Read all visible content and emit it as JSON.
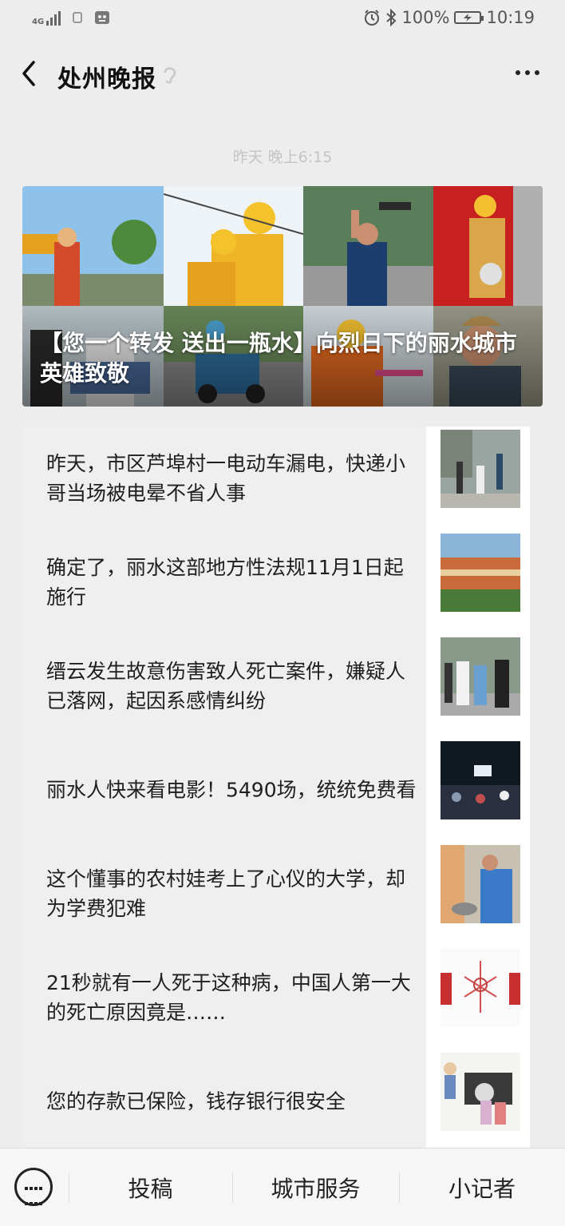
{
  "status": {
    "network": "4G",
    "battery": "100%",
    "time": "10:19"
  },
  "header": {
    "title": "处州晚报"
  },
  "message": {
    "timestamp": "昨天 晚上6:15",
    "hero_title": "【您一个转发 送出一瓶水】向烈日下的丽水城市英雄致敬",
    "articles": [
      {
        "title": "昨天，市区芦埠村一电动车漏电，快递小哥当场被电晕不省人事"
      },
      {
        "title": "确定了，丽水这部地方性法规11月1日起施行"
      },
      {
        "title": "缙云发生故意伤害致人死亡案件，嫌疑人已落网，起因系感情纠纷"
      },
      {
        "title": "丽水人快来看电影！5490场，统统免费看"
      },
      {
        "title": "这个懂事的农村娃考上了心仪的大学，却为学费犯难"
      },
      {
        "title": "21秒就有一人死于这种病，中国人第一大的死亡原因竟是……"
      },
      {
        "title": "您的存款已保险，钱存银行很安全"
      }
    ]
  },
  "bottom_menu": {
    "items": [
      "投稿",
      "城市服务",
      "小记者"
    ]
  }
}
